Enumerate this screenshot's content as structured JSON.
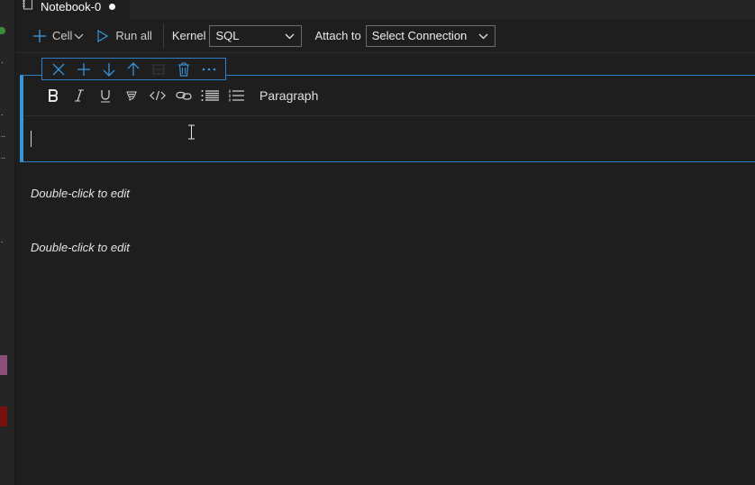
{
  "tab": {
    "title": "Notebook-0"
  },
  "toolbar": {
    "cell_label": "Cell",
    "run_all_label": "Run all",
    "kernel_label": "Kernel",
    "kernel_value": "SQL",
    "attach_label": "Attach to",
    "attach_value": "Select Connection"
  },
  "markdown_toolbar": {
    "paragraph_label": "Paragraph"
  },
  "cells": [
    {
      "placeholder": "Double-click to edit"
    },
    {
      "placeholder": "Double-click to edit"
    }
  ],
  "colors": {
    "accent": "#3794d9",
    "background": "#1e1e1e"
  }
}
